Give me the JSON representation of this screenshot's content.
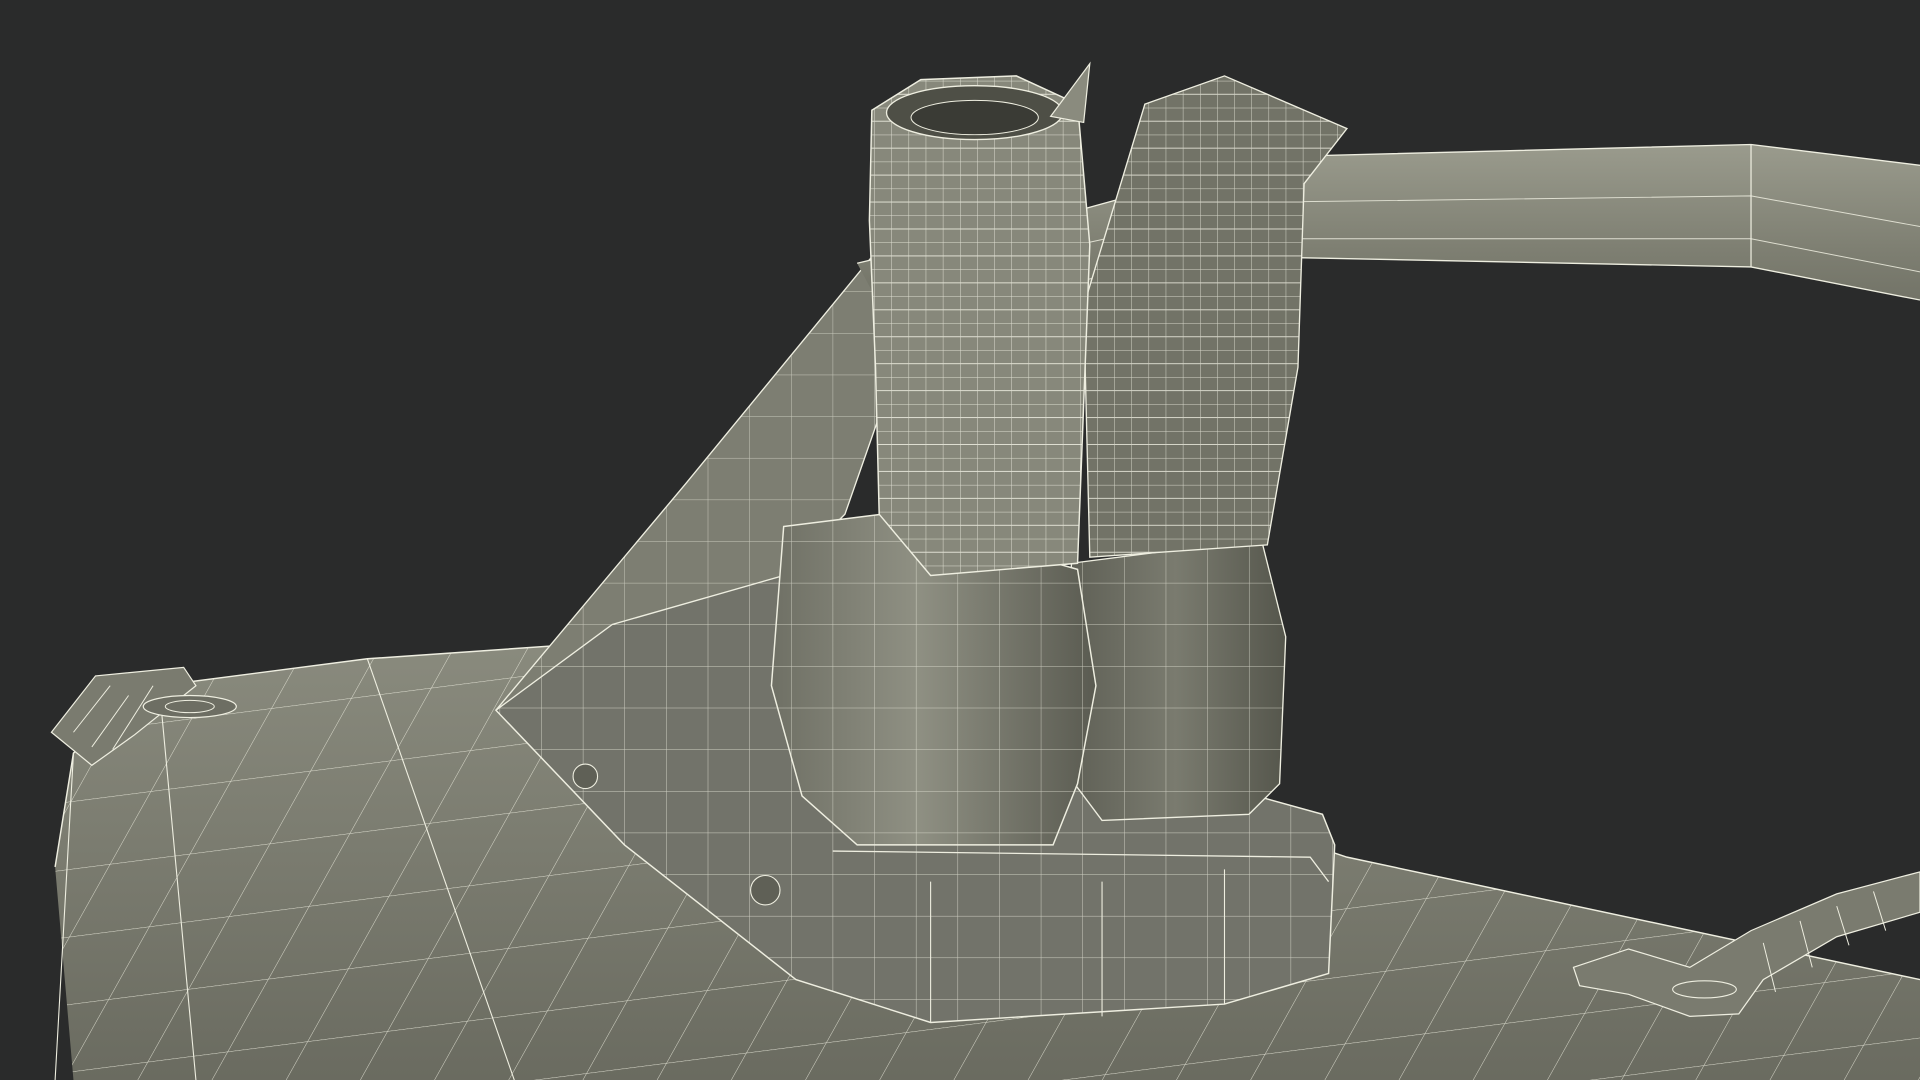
{
  "scene": {
    "subject": "wireframe-3d-render",
    "colors": {
      "background": "#2a2b2b",
      "surface": "#7b7c6f",
      "surface_light": "#8c8d80",
      "surface_dark": "#55564c",
      "wire": "#eeeee0"
    }
  }
}
